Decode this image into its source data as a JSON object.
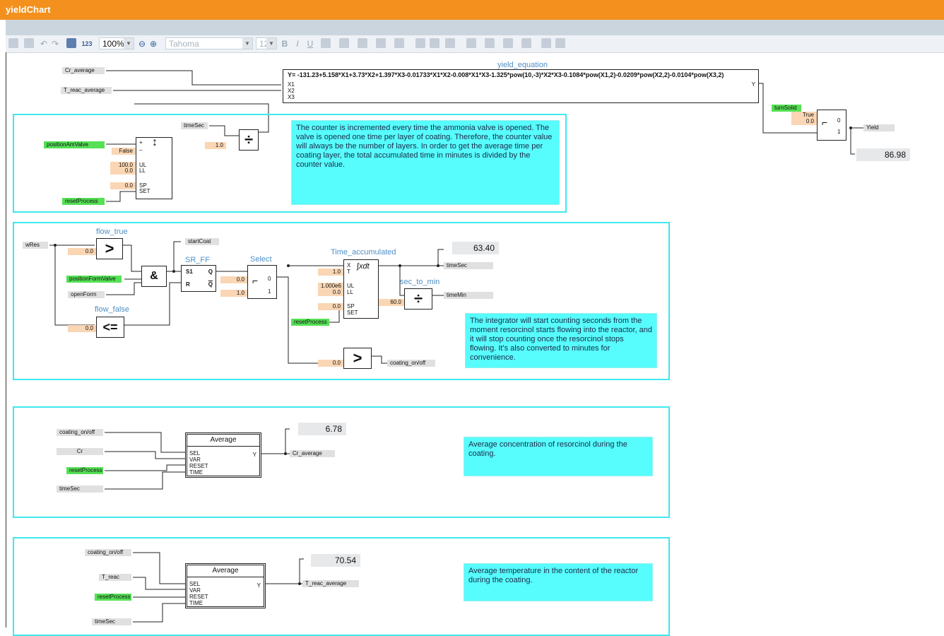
{
  "window": {
    "title": "yieldChart"
  },
  "toolbar": {
    "zoom": "100%",
    "font": "Tahoma",
    "font_size": "12",
    "bold": "B",
    "italic": "I",
    "underline": "U",
    "num_format": "123"
  },
  "signals": {
    "cr_average": "Cr_average",
    "t_reac_average": "T_reac_average",
    "time_sec": "timeSec",
    "position_am_valve": "positionAmValve",
    "reset_process": "resetProcess",
    "turn_solid": "turnSolid",
    "yield": "Yield",
    "w_res": "wRes",
    "position_form_valve": "positionFormValve",
    "open_form": "openForm",
    "start_coat": "startCoat",
    "time_min": "timeMin",
    "coating_on_off": "coating_on/off",
    "cr": "Cr",
    "t_reac": "T_reac"
  },
  "yield_equation": {
    "title": "yield_equation",
    "formula": "Y= -131.23+5.158*X1+3.73*X2+1.397*X3-0.01733*X1*X2-0.008*X1*X3-1.325*pow(10,-3)*X2*X3-0.1084*pow(X1,2)-0.0209*pow(X2,2)-0.0104*pow(X3,2)",
    "inputs": [
      "X1",
      "X2",
      "X3"
    ],
    "output": "Y"
  },
  "switch_yield": {
    "true_label": "True",
    "value": "0.0",
    "pos0": "0",
    "pos1": "1",
    "display": "86.98"
  },
  "counter": {
    "false_label": "False",
    "ul": "100.0",
    "ll": "0.0",
    "sp": "0.0",
    "ports": {
      "ul": "UL",
      "ll": "LL",
      "sp": "SP",
      "set": "SET",
      "plus": "+",
      "minus": "–"
    }
  },
  "divide": {
    "const": "1.0",
    "symbol": "÷"
  },
  "notes": {
    "counter": "The counter is incremented every time the ammonia valve is opened. The valve is opened one time per layer of coating. Therefore, the counter value will always be the number of layers. In order to get the average time per coating layer, the total accumulated time in minutes is divided by the counter value.",
    "integrator": "The integrator will start counting seconds from the moment resorcinol starts flowing into the reactor, and it will stop counting once the resorcinol stops flowing. It's also converted to minutes for convenience.",
    "cr_avg": "Average concentration of resorcinol during the coating.",
    "t_avg": "Average temperature in the content of the reactor during the coating."
  },
  "flow": {
    "flow_true": "flow_true",
    "flow_false": "flow_false",
    "gt": ">",
    "le": "<=",
    "and": "&",
    "const_true": "0.0",
    "const_false": "0.0"
  },
  "sr_ff": {
    "title": "SR_FF",
    "s": "S1",
    "r": "R",
    "q": "Q",
    "qbar": "Q"
  },
  "select": {
    "title": "Select",
    "in0": "0.0",
    "in1": "1.0",
    "pos0": "0",
    "pos1": "1"
  },
  "time_accumulated": {
    "title": "Time_accumulated",
    "x": "X",
    "t": "T",
    "t_val": "1.0",
    "ul": "UL",
    "ul_val": "1.000e6",
    "ll": "LL",
    "ll_val": "0.0",
    "sp": "SP",
    "sp_val": "0.0",
    "set": "SET",
    "symbol": "∫xdt",
    "display": "63.40"
  },
  "sec_to_min": {
    "title": "sec_to_min",
    "const": "60.0",
    "symbol": "÷"
  },
  "coating_cmp": {
    "const": "0.0",
    "symbol": ">"
  },
  "avg_cr": {
    "title": "Average",
    "ports": [
      "SEL",
      "VAR",
      "RESET",
      "TIME"
    ],
    "output": "Y",
    "display": "6.78"
  },
  "avg_t": {
    "title": "Average",
    "ports": [
      "SEL",
      "VAR",
      "RESET",
      "TIME"
    ],
    "output": "Y",
    "display": "70.54"
  },
  "colors": {
    "titlebar": "#f3901e",
    "panel_border": "#3ee8ee",
    "note_bg": "#57fcfc",
    "green_tag": "#55e055",
    "peach_tag": "#fad6b4"
  }
}
